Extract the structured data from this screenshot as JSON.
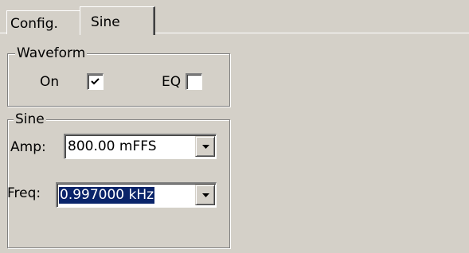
{
  "tabs": [
    {
      "label": "Config.",
      "active": false
    },
    {
      "label": "Sine",
      "active": true
    }
  ],
  "waveform": {
    "title": "Waveform",
    "on_label": "On",
    "on_checked": true,
    "eq_label": "EQ",
    "eq_checked": false
  },
  "sine": {
    "title": "Sine",
    "amp_label": "Amp:",
    "amp_value": "800.00 mFFS",
    "freq_label": "Freq:",
    "freq_value": "0.997000 kHz"
  },
  "colors": {
    "face": "#d4d0c8",
    "selection": "#0a246a"
  },
  "icons": {
    "check": "check-icon",
    "dropdown": "chevron-down-icon"
  }
}
